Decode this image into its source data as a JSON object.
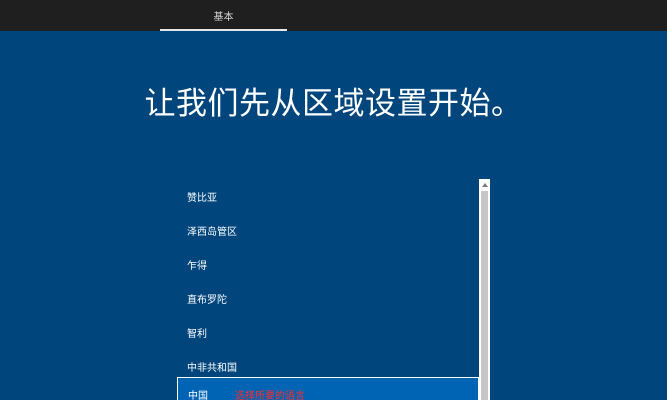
{
  "top_bar": {
    "tab_label": "基本"
  },
  "headline": "让我们先从区域设置开始。",
  "region_list": {
    "items": [
      {
        "label": "赞比亚"
      },
      {
        "label": "泽西岛管区"
      },
      {
        "label": "乍得"
      },
      {
        "label": "直布罗陀"
      },
      {
        "label": "智利"
      },
      {
        "label": "中非共和国"
      },
      {
        "label": "中国",
        "annotation": "选择所要的语言"
      }
    ]
  },
  "colors": {
    "background": "#00457c",
    "top_bar": "#1f1f1f",
    "selected_item": "#0064b5",
    "annotation": "#ff2b2b"
  }
}
